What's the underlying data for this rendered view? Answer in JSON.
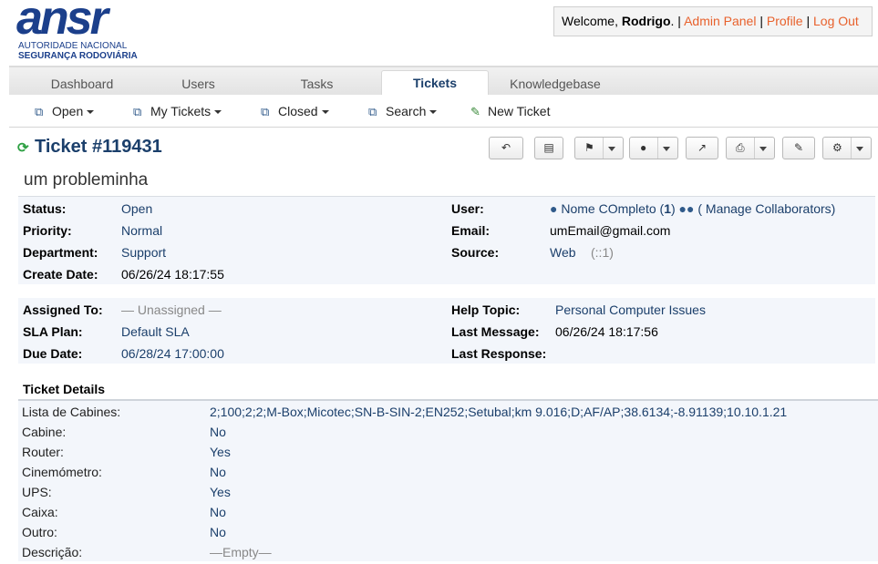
{
  "logo": {
    "big": "ansr",
    "line1": "AUTORIDADE NACIONAL",
    "line2": "SEGURANÇA RODOVIÁRIA"
  },
  "welcome": {
    "prefix": "Welcome, ",
    "user": "Rodrigo",
    "suffix": ". | ",
    "admin_panel": "Admin Panel",
    "sep1": " | ",
    "profile": "Profile",
    "sep2": " | ",
    "logout": "Log Out"
  },
  "nav": {
    "tabs": [
      {
        "label": "Dashboard"
      },
      {
        "label": "Users"
      },
      {
        "label": "Tasks"
      },
      {
        "label": "Tickets"
      },
      {
        "label": "Knowledgebase"
      }
    ],
    "active": "Tickets"
  },
  "subnav": {
    "items": [
      {
        "label": "Open",
        "icon": "stack-icon"
      },
      {
        "label": "My Tickets",
        "icon": "stack-icon"
      },
      {
        "label": "Closed",
        "icon": "stack-icon"
      },
      {
        "label": "Search",
        "icon": "stack-icon"
      },
      {
        "label": "New Ticket",
        "icon": "new-ticket-icon"
      }
    ]
  },
  "ticket": {
    "title": "Ticket #119431",
    "subject": "um probleminha",
    "actions": [
      "reply-icon",
      "note-icon",
      "flag-icon",
      "user-icon",
      "transfer-icon",
      "print-icon",
      "edit-icon",
      "gear-icon"
    ]
  },
  "info1": {
    "status_label": "Status:",
    "status": "Open",
    "priority_label": "Priority:",
    "priority": "Normal",
    "department_label": "Department:",
    "department": "Support",
    "create_label": "Create Date:",
    "create": "06/26/24 18:17:55",
    "user_label": "User:",
    "user_name": "Nome COmpleto",
    "user_count_open": " (",
    "user_count": "1",
    "user_count_close": ")",
    "manage": "( Manage Collaborators)",
    "email_label": "Email:",
    "email": "umEmail@gmail.com",
    "source_label": "Source:",
    "source": "Web",
    "source_extra": "(::1)"
  },
  "info2": {
    "assigned_label": "Assigned To:",
    "assigned": "— Unassigned —",
    "sla_label": "SLA Plan:",
    "sla": "Default SLA",
    "due_label": "Due Date:",
    "due": "06/28/24 17:00:00",
    "help_label": "Help Topic:",
    "help": "Personal Computer Issues",
    "lastmsg_label": "Last Message:",
    "lastmsg": "06/26/24 18:17:56",
    "lastresp_label": "Last Response:",
    "lastresp": ""
  },
  "details": {
    "heading": "Ticket Details",
    "rows": [
      {
        "label": "Lista de Cabines:",
        "value": "2;100;2;2;M-Box;Micotec;SN-B-SIN-2;EN252;Setubal;km 9.016;D;AF/AP;38.6134;-8.91139;10.10.1.21"
      },
      {
        "label": "Cabine:",
        "value": "No"
      },
      {
        "label": "Router:",
        "value": "Yes"
      },
      {
        "label": "Cinemómetro:",
        "value": "No"
      },
      {
        "label": "UPS:",
        "value": "Yes"
      },
      {
        "label": "Caixa:",
        "value": "No"
      },
      {
        "label": "Outro:",
        "value": "No"
      },
      {
        "label": "Descrição:",
        "value": "—Empty—"
      }
    ]
  },
  "colors": {
    "brand": "#1b3f8b",
    "link_orange": "#e8612c",
    "value_blue": "#1b3f6b",
    "refresh_green": "#2ea043"
  }
}
